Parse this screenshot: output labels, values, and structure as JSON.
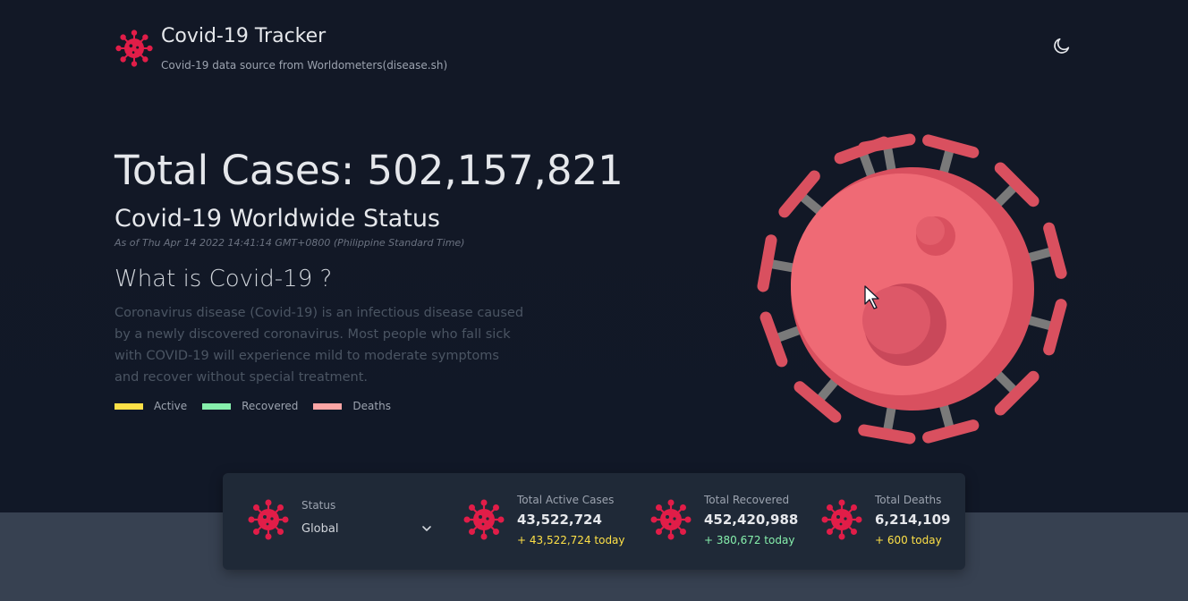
{
  "app": {
    "title": "Covid-19 Tracker",
    "subtitle": "Covid-19 data source from Worldometers(disease.sh)"
  },
  "hero": {
    "total_cases": "Total Cases: 502,157,821",
    "worldwide_status": "Covid-19 Worldwide Status",
    "as_of": "As of Thu Apr 14 2022 14:41:14 GMT+0800 (Philippine Standard Time)",
    "what_is_heading": "What is Covid-19 ?",
    "description": "Coronavirus disease (Covid-19) is an infectious disease caused by a newly discovered coronavirus. Most people who fall sick with COVID-19 will experience mild to moderate symptoms and recover without special treatment."
  },
  "legend": [
    {
      "label": "Active",
      "color": "#fde047"
    },
    {
      "label": "Recovered",
      "color": "#86efac"
    },
    {
      "label": "Deaths",
      "color": "#fca5a5"
    }
  ],
  "stats": {
    "status_label": "Status",
    "status_value": "Global",
    "active": {
      "title": "Total Active Cases",
      "value": "43,522,724",
      "today": "+ 43,522,724 today",
      "color": "#fde047"
    },
    "recovered": {
      "title": "Total Recovered",
      "value": "452,420,988",
      "today": "+ 380,672 today",
      "color": "#86efac"
    },
    "deaths": {
      "title": "Total Deaths",
      "value": "6,214,109",
      "today": "+ 600 today",
      "color": "#fde047"
    }
  },
  "icons": {
    "brand": "virus-icon",
    "theme": "moon-icon",
    "dropdown": "chevron-down-icon"
  },
  "colors": {
    "background": "#111827",
    "card": "#1f2937",
    "virus": "#e11d48",
    "virus_art_body": "#ef6a75"
  }
}
